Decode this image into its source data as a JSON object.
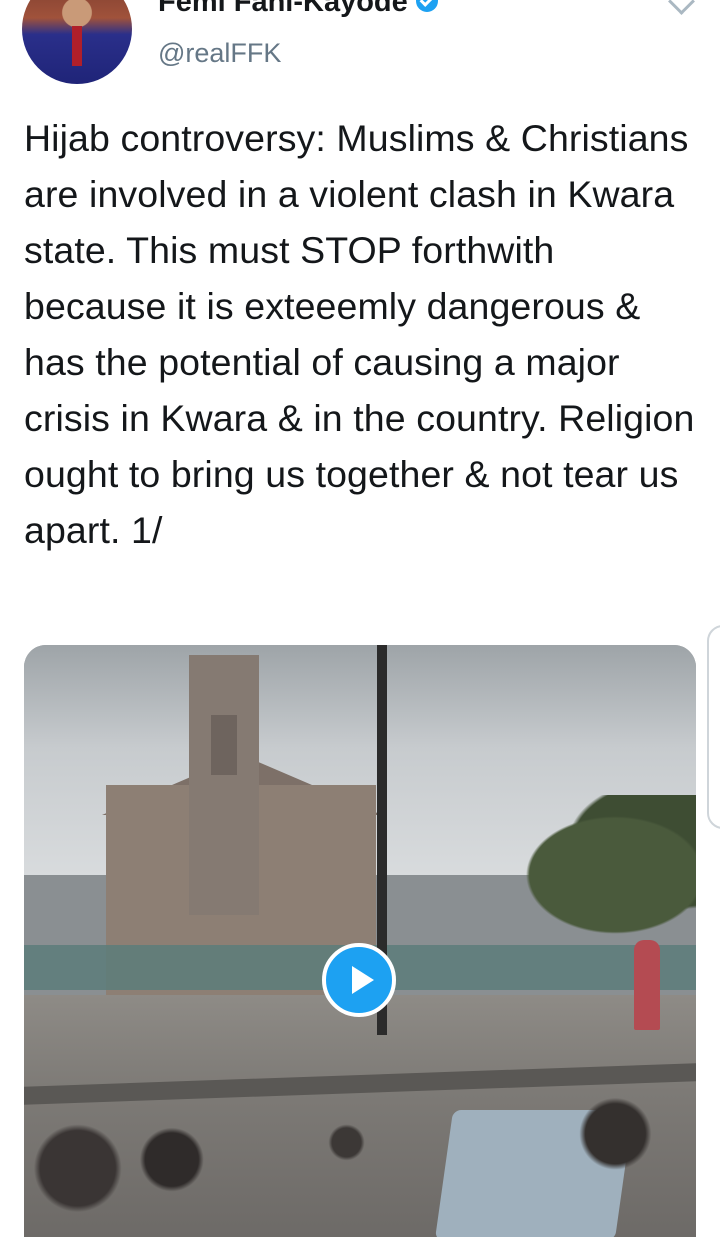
{
  "header": {
    "name": "Femi Fani-Kayode",
    "handle": "@realFFK"
  },
  "tweet": {
    "text": "Hijab controversy: Muslims & Christians are involved in a violent clash in Kwara state. This must STOP forthwith because it is exteeemly dangerous & has the potential of causing a major crisis in Kwara & in the country. Religion ought to bring us together & not tear us apart. 1/"
  },
  "icons": {
    "verified": "verified-badge-icon",
    "menu": "chevron-down-icon",
    "play": "play-icon"
  },
  "colors": {
    "accent": "#1da1f2",
    "text": "#14171a",
    "secondary": "#657786"
  }
}
